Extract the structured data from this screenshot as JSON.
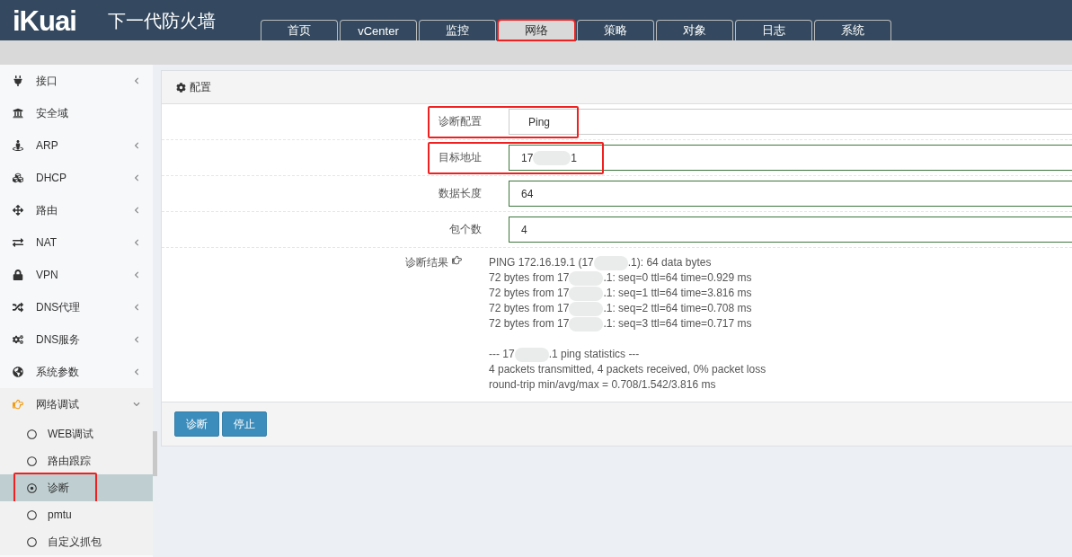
{
  "header": {
    "logo": "iKuai",
    "title": "下一代防火墙"
  },
  "tabs": [
    {
      "label": "首页",
      "selected": false,
      "annotated": false
    },
    {
      "label": "vCenter",
      "selected": false,
      "annotated": false
    },
    {
      "label": "监控",
      "selected": false,
      "annotated": false
    },
    {
      "label": "网络",
      "selected": true,
      "annotated": true
    },
    {
      "label": "策略",
      "selected": false,
      "annotated": false
    },
    {
      "label": "对象",
      "selected": false,
      "annotated": false
    },
    {
      "label": "日志",
      "selected": false,
      "annotated": false
    },
    {
      "label": "系统",
      "selected": false,
      "annotated": false
    }
  ],
  "sidebar": {
    "items": [
      {
        "label": "接口",
        "kind": "group",
        "expanded": false
      },
      {
        "label": "安全域",
        "kind": "leaf"
      },
      {
        "label": "ARP",
        "kind": "group",
        "expanded": false
      },
      {
        "label": "DHCP",
        "kind": "group",
        "expanded": false
      },
      {
        "label": "路由",
        "kind": "group",
        "expanded": false
      },
      {
        "label": "NAT",
        "kind": "group",
        "expanded": false
      },
      {
        "label": "VPN",
        "kind": "group",
        "expanded": false
      },
      {
        "label": "DNS代理",
        "kind": "group",
        "expanded": false
      },
      {
        "label": "DNS服务",
        "kind": "group",
        "expanded": false
      },
      {
        "label": "系统参数",
        "kind": "group",
        "expanded": false
      },
      {
        "label": "网络调试",
        "kind": "group",
        "expanded": true,
        "children": [
          {
            "label": "WEB调试",
            "selected": false,
            "annotated": false
          },
          {
            "label": "路由跟踪",
            "selected": false,
            "annotated": false
          },
          {
            "label": "诊断",
            "selected": true,
            "annotated": true
          },
          {
            "label": "pmtu",
            "selected": false,
            "annotated": false
          },
          {
            "label": "自定义抓包",
            "selected": false,
            "annotated": false
          }
        ]
      }
    ]
  },
  "panel": {
    "title": "配置",
    "fields": [
      {
        "label": "诊断配置",
        "kind": "select",
        "value": "Ping",
        "annotated": true
      },
      {
        "label": "目标地址",
        "kind": "input",
        "value_start": "17",
        "value_end": "1",
        "redacted": true,
        "annotated": true
      },
      {
        "label": "数据长度",
        "kind": "input",
        "value": "64",
        "annotated": false
      },
      {
        "label": "包个数",
        "kind": "input",
        "value": "4",
        "annotated": false
      }
    ],
    "result": {
      "label": "诊断结果",
      "lines": [
        {
          "kind": "redacted",
          "start": "PING 172.16.19.1 (17",
          "end": ".1): 64 data bytes"
        },
        {
          "kind": "redacted",
          "start": "72 bytes from 17",
          "end": ".1: seq=0 ttl=64 time=0.929 ms"
        },
        {
          "kind": "redacted",
          "start": "72 bytes from 17",
          "end": ".1: seq=1 ttl=64 time=3.816 ms"
        },
        {
          "kind": "redacted",
          "start": "72 bytes from 17",
          "end": ".1: seq=2 ttl=64 time=0.708 ms"
        },
        {
          "kind": "redacted",
          "start": "72 bytes from 17",
          "end": ".1: seq=3 ttl=64 time=0.717 ms"
        },
        {
          "kind": "blank"
        },
        {
          "kind": "redacted",
          "start": "--- 17",
          "end": ".1 ping statistics ---"
        },
        {
          "kind": "plain",
          "text": "4 packets transmitted, 4 packets received, 0% packet loss"
        },
        {
          "kind": "plain",
          "text": "round-trip min/avg/max = 0.708/1.542/3.816 ms"
        }
      ]
    },
    "buttons": [
      "诊断",
      "停止"
    ]
  }
}
